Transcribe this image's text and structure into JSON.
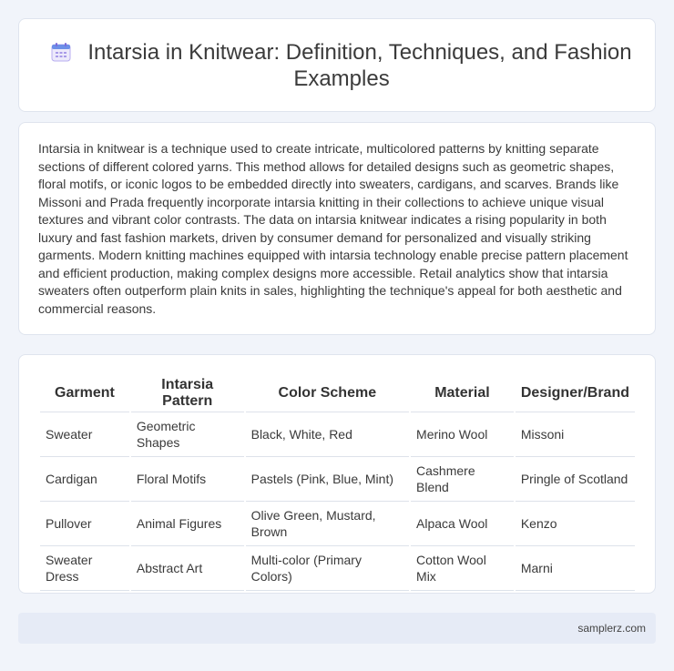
{
  "header": {
    "title": "Intarsia in Knitwear: Definition, Techniques, and Fashion Examples",
    "icon": "calendar-icon"
  },
  "description": "Intarsia in knitwear is a technique used to create intricate, multicolored patterns by knitting separate sections of different colored yarns. This method allows for detailed designs such as geometric shapes, floral motifs, or iconic logos to be embedded directly into sweaters, cardigans, and scarves. Brands like Missoni and Prada frequently incorporate intarsia knitting in their collections to achieve unique visual textures and vibrant color contrasts. The data on intarsia knitwear indicates a rising popularity in both luxury and fast fashion markets, driven by consumer demand for personalized and visually striking garments. Modern knitting machines equipped with intarsia technology enable precise pattern placement and efficient production, making complex designs more accessible. Retail analytics show that intarsia sweaters often outperform plain knits in sales, highlighting the technique's appeal for both aesthetic and commercial reasons.",
  "table": {
    "headers": [
      "Garment",
      "Intarsia Pattern",
      "Color Scheme",
      "Material",
      "Designer/Brand"
    ],
    "rows": [
      [
        "Sweater",
        "Geometric Shapes",
        "Black, White, Red",
        "Merino Wool",
        "Missoni"
      ],
      [
        "Cardigan",
        "Floral Motifs",
        "Pastels (Pink, Blue, Mint)",
        "Cashmere Blend",
        "Pringle of Scotland"
      ],
      [
        "Pullover",
        "Animal Figures",
        "Olive Green, Mustard, Brown",
        "Alpaca Wool",
        "Kenzo"
      ],
      [
        "Sweater Dress",
        "Abstract Art",
        "Multi-color (Primary Colors)",
        "Cotton Wool Mix",
        "Marni"
      ]
    ]
  },
  "footer": {
    "site": "samplerz.com"
  },
  "colors": {
    "background": "#f1f4fa",
    "card": "#ffffff",
    "footer": "#e6ebf6",
    "icon_accent": "#8c7ae6"
  }
}
